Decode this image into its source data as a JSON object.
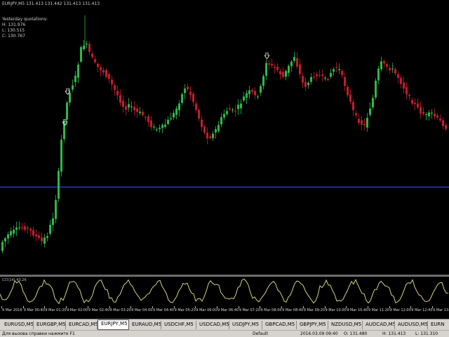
{
  "chart": {
    "header": "EURJPY,M5  131.413 131.442 131.413 131.413",
    "quotes": {
      "title": "Yesterday quotations:",
      "high": "H: 131.976",
      "low": "L: 130.515",
      "close": "C: 130.767"
    },
    "indicator_label": "CCI(14) 43.26",
    "colors": {
      "background": "#000000",
      "bull": "#2db84a",
      "bear": "#c21d2b",
      "level_line": "#1c2b8c",
      "indicator_line": "#d8d27a"
    },
    "time_labels": [
      "9 Mar 2016",
      "9 Mar 00:40",
      "9 Mar 01:20",
      "9 Mar 02:00",
      "9 Mar 02:40",
      "9 Mar 03:20",
      "9 Mar 04:00",
      "9 Mar 04:40",
      "9 Mar 05:20",
      "9 Mar 06:00",
      "9 Mar 06:40",
      "9 Mar 07:20",
      "9 Mar 08:00",
      "9 Mar 08:40",
      "9 Mar 09:20",
      "9 Mar 10:00",
      "9 Mar 10:40",
      "9 Mar 11:20",
      "9 Mar 12:00",
      "9 Mar 12:40",
      "9 Mar 13:20"
    ]
  },
  "tabs": [
    {
      "label": "EURUSD,M5",
      "active": false
    },
    {
      "label": "EURGBP,M5",
      "active": false
    },
    {
      "label": "EURCAD,M5",
      "active": false
    },
    {
      "label": "EURJPY,M5",
      "active": true
    },
    {
      "label": "EURAUD,M5",
      "active": false
    },
    {
      "label": "USDCHF,M5",
      "active": false
    },
    {
      "label": "USDCAD,M5",
      "active": false
    },
    {
      "label": "USDJPY,M5",
      "active": false
    },
    {
      "label": "GBPCAD,M5",
      "active": false
    },
    {
      "label": "GBPJPY,M5",
      "active": false
    },
    {
      "label": "NZDUSD,M5",
      "active": false
    },
    {
      "label": "AUDCAD,M5",
      "active": false
    },
    {
      "label": "AUDUSD,M5",
      "active": false
    },
    {
      "label": "EURN",
      "active": false
    }
  ],
  "status": {
    "help": "Для вызова справки нажмите F1",
    "profile": "Default",
    "datetime": "2016.03.09 09:40",
    "open": "O: 131.480",
    "high": "H: 131.413",
    "low": "L: 131.310"
  }
}
